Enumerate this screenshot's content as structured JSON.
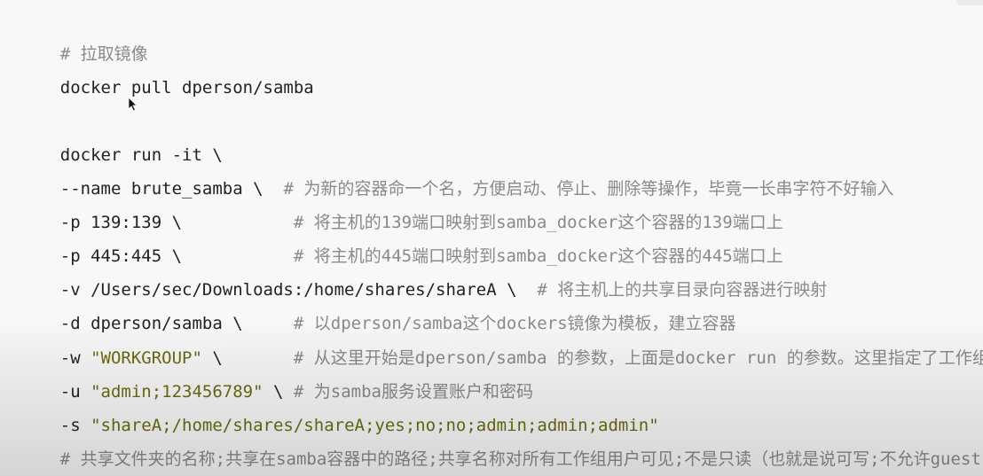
{
  "lines": [
    {
      "comment": "# 拉取镜像"
    },
    {
      "code": "docker pull dperson/samba"
    },
    {
      "code": "docker run -it \\"
    },
    {
      "code": "--name brute_samba \\  ",
      "comment": "# 为新的容器命一个名，方便启动、停止、删除等操作，毕竟一长串字符不好输入"
    },
    {
      "code": "-p 139:139 \\           ",
      "comment": "# 将主机的139端口映射到samba_docker这个容器的139端口上"
    },
    {
      "code": "-p 445:445 \\           ",
      "comment": "# 将主机的445端口映射到samba_docker这个容器的445端口上"
    },
    {
      "code": "-v /Users/sec/Downloads:/home/shares/shareA \\  ",
      "comment": "# 将主机上的共享目录向容器进行映射"
    },
    {
      "code": "-d dperson/samba \\     ",
      "comment": "# 以dperson/samba这个dockers镜像为模板，建立容器"
    },
    {
      "code_pre": "-w ",
      "string": "\"WORKGROUP\"",
      "code_post": " \\       ",
      "comment": "# 从这里开始是dperson/samba 的参数，上面是docker run 的参数。这里指定了工作组"
    },
    {
      "code_pre": "-u ",
      "string": "\"admin;123456789\"",
      "code_post": " \\ ",
      "comment": "# 为samba服务设置账户和密码"
    },
    {
      "code_pre": "-s ",
      "string": "\"shareA;/home/shares/shareA;yes;no;no;admin;admin;admin\""
    },
    {
      "comment": "# 共享文件夹的名称;共享在samba容器中的路径;共享名称对所有工作组用户可见;不是只读（也就是说可写;不允许guest"
    }
  ],
  "cursor_icon": "mouse-pointer-icon"
}
